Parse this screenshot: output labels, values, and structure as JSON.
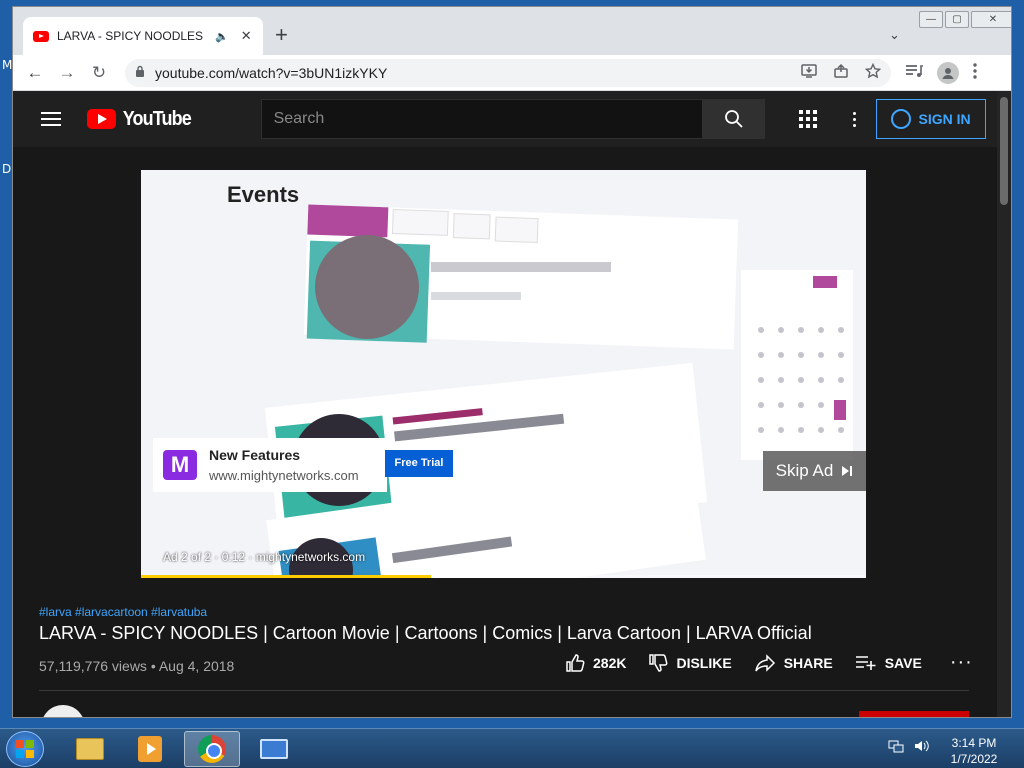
{
  "desktop": {
    "labels": [
      "M",
      "D"
    ]
  },
  "browser": {
    "tab": {
      "title": "LARVA - SPICY NOODLES | C",
      "speaker": "🔈",
      "close": "✕"
    },
    "new_tab": "+",
    "tab_menu": "⌄",
    "window_controls": {
      "minimize": "—",
      "maximize": "▢",
      "close": "✕"
    },
    "toolbar": {
      "back": "←",
      "forward": "→",
      "reload": "↻",
      "lock": "🔒",
      "url": "youtube.com/watch?v=3bUN1izkYKY"
    }
  },
  "youtube": {
    "logo_text": "YouTube",
    "search_placeholder": "Search",
    "sign_in": "SIGN IN"
  },
  "ad": {
    "visual_heading": "Events",
    "title": "New Features",
    "domain": "www.mightynetworks.com",
    "logo_letter": "M",
    "cta": "Free Trial",
    "skip_label": "Skip Ad",
    "meta": "Ad 2 of 2 · 0:12 · mightynetworks.com",
    "progress_fraction": 0.4
  },
  "video": {
    "hashtags": "#larva #larvacartoon #larvatuba",
    "title": "LARVA - SPICY NOODLES | Cartoon Movie | Cartoons | Comics | Larva Cartoon | LARVA Official",
    "views_date": "57,119,776 views • Aug 4, 2018",
    "likes": "282K",
    "dislike": "DISLIKE",
    "share": "SHARE",
    "save": "SAVE",
    "more": "···"
  },
  "taskbar": {
    "time": "3:14 PM",
    "date": "1/7/2022"
  },
  "colors": {
    "accent": "#3ea6ff",
    "yt_red": "#ff0000",
    "ad_blue": "#065fd4",
    "progress": "#ffcc00"
  }
}
